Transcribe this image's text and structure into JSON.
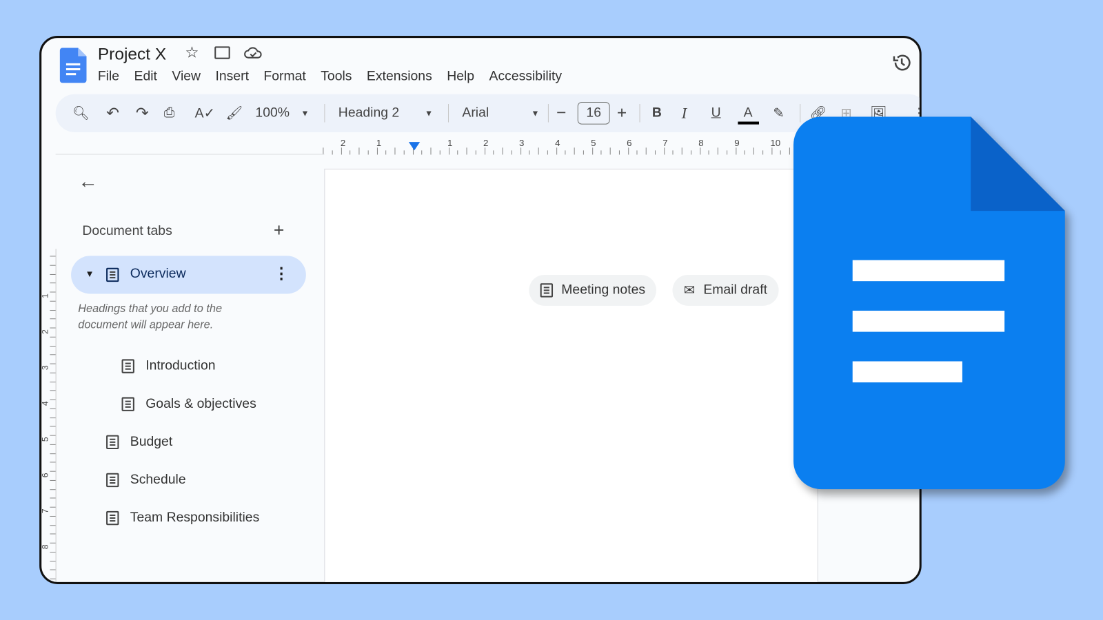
{
  "app": {
    "title": "Project X",
    "menu": [
      "File",
      "Edit",
      "View",
      "Insert",
      "Format",
      "Tools",
      "Extensions",
      "Help",
      "Accessibility"
    ]
  },
  "toolbar": {
    "zoom": "100%",
    "style": "Heading 2",
    "font": "Arial",
    "font_size": "16",
    "bold": "B",
    "italic": "I",
    "underline": "U",
    "text_color": "A"
  },
  "ruler": {
    "ticks": [
      "2",
      "1",
      "1",
      "2",
      "3",
      "4",
      "5",
      "6",
      "7",
      "8",
      "9",
      "10"
    ]
  },
  "vruler": {
    "ticks": [
      "1",
      "2",
      "3",
      "4",
      "5",
      "6",
      "7",
      "8"
    ]
  },
  "sidebar": {
    "title": "Document tabs",
    "hint": "Headings that you add to the document will appear here.",
    "tabs": [
      {
        "label": "Overview"
      },
      {
        "label": "Introduction"
      },
      {
        "label": "Goals & objectives"
      },
      {
        "label": "Budget"
      },
      {
        "label": "Schedule"
      },
      {
        "label": "Team Responsibilities"
      }
    ]
  },
  "chips": {
    "meeting": "Meeting notes",
    "email": "Email draft"
  },
  "colors": {
    "background": "#a8cdfd",
    "brand": "#0b7ff0",
    "selected_tab": "#d3e3fd"
  }
}
